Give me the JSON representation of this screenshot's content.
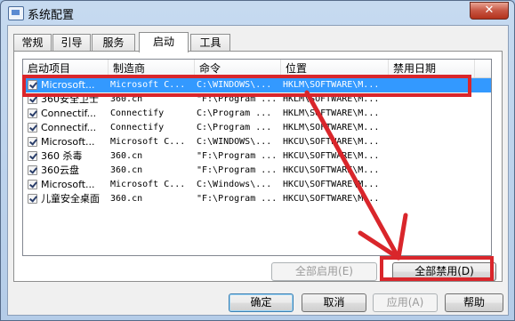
{
  "window": {
    "title": "系统配置",
    "close_glyph": "✕"
  },
  "tabs": [
    {
      "label": "常规"
    },
    {
      "label": "引导"
    },
    {
      "label": "服务"
    },
    {
      "label": "启动",
      "active": true
    },
    {
      "label": "工具"
    }
  ],
  "columns": [
    "启动项目",
    "制造商",
    "命令",
    "位置",
    "禁用日期"
  ],
  "rows": [
    {
      "checked": true,
      "item": "Microsoft...",
      "maker": "Microsoft C...",
      "command": "C:\\WINDOWS\\...",
      "location": "HKLM\\SOFTWARE\\M...",
      "date": "",
      "selected": true
    },
    {
      "checked": true,
      "item": "360安全卫士",
      "maker": "360.cn",
      "command": "\"F:\\Program ...",
      "location": "HKLM\\SOFTWARE\\M...",
      "date": ""
    },
    {
      "checked": true,
      "item": "Connectif...",
      "maker": "Connectify",
      "command": "C:\\Program ...",
      "location": "HKLM\\SOFTWARE\\M...",
      "date": ""
    },
    {
      "checked": true,
      "item": "Connectif...",
      "maker": "Connectify",
      "command": "C:\\Program ...",
      "location": "HKLM\\SOFTWARE\\M...",
      "date": ""
    },
    {
      "checked": true,
      "item": "Microsoft...",
      "maker": "Microsoft C...",
      "command": "C:\\WINDOWS\\...",
      "location": "HKCU\\SOFTWARE\\M...",
      "date": ""
    },
    {
      "checked": true,
      "item": "360 杀毒",
      "maker": "360.cn",
      "command": "\"F:\\Program ...",
      "location": "HKCU\\SOFTWARE\\M...",
      "date": ""
    },
    {
      "checked": true,
      "item": "360云盘",
      "maker": "360.cn",
      "command": "\"F:\\Program ...",
      "location": "HKCU\\SOFTWARE\\M...",
      "date": ""
    },
    {
      "checked": true,
      "item": "Microsoft...",
      "maker": "Microsoft C...",
      "command": "C:\\Windows\\...",
      "location": "HKCU\\SOFTWARE\\M...",
      "date": ""
    },
    {
      "checked": true,
      "item": "儿童安全桌面",
      "maker": "360.cn",
      "command": "\"F:\\Program ...",
      "location": "HKCU\\SOFTWARE\\M...",
      "date": ""
    }
  ],
  "panel_buttons": {
    "enable_all": "全部启用(E)",
    "disable_all": "全部禁用(D)"
  },
  "dialog_buttons": {
    "ok": "确定",
    "cancel": "取消",
    "apply": "应用(A)",
    "help": "帮助"
  },
  "colors": {
    "annotation": "#d9262b",
    "selection": "#3399ff"
  }
}
